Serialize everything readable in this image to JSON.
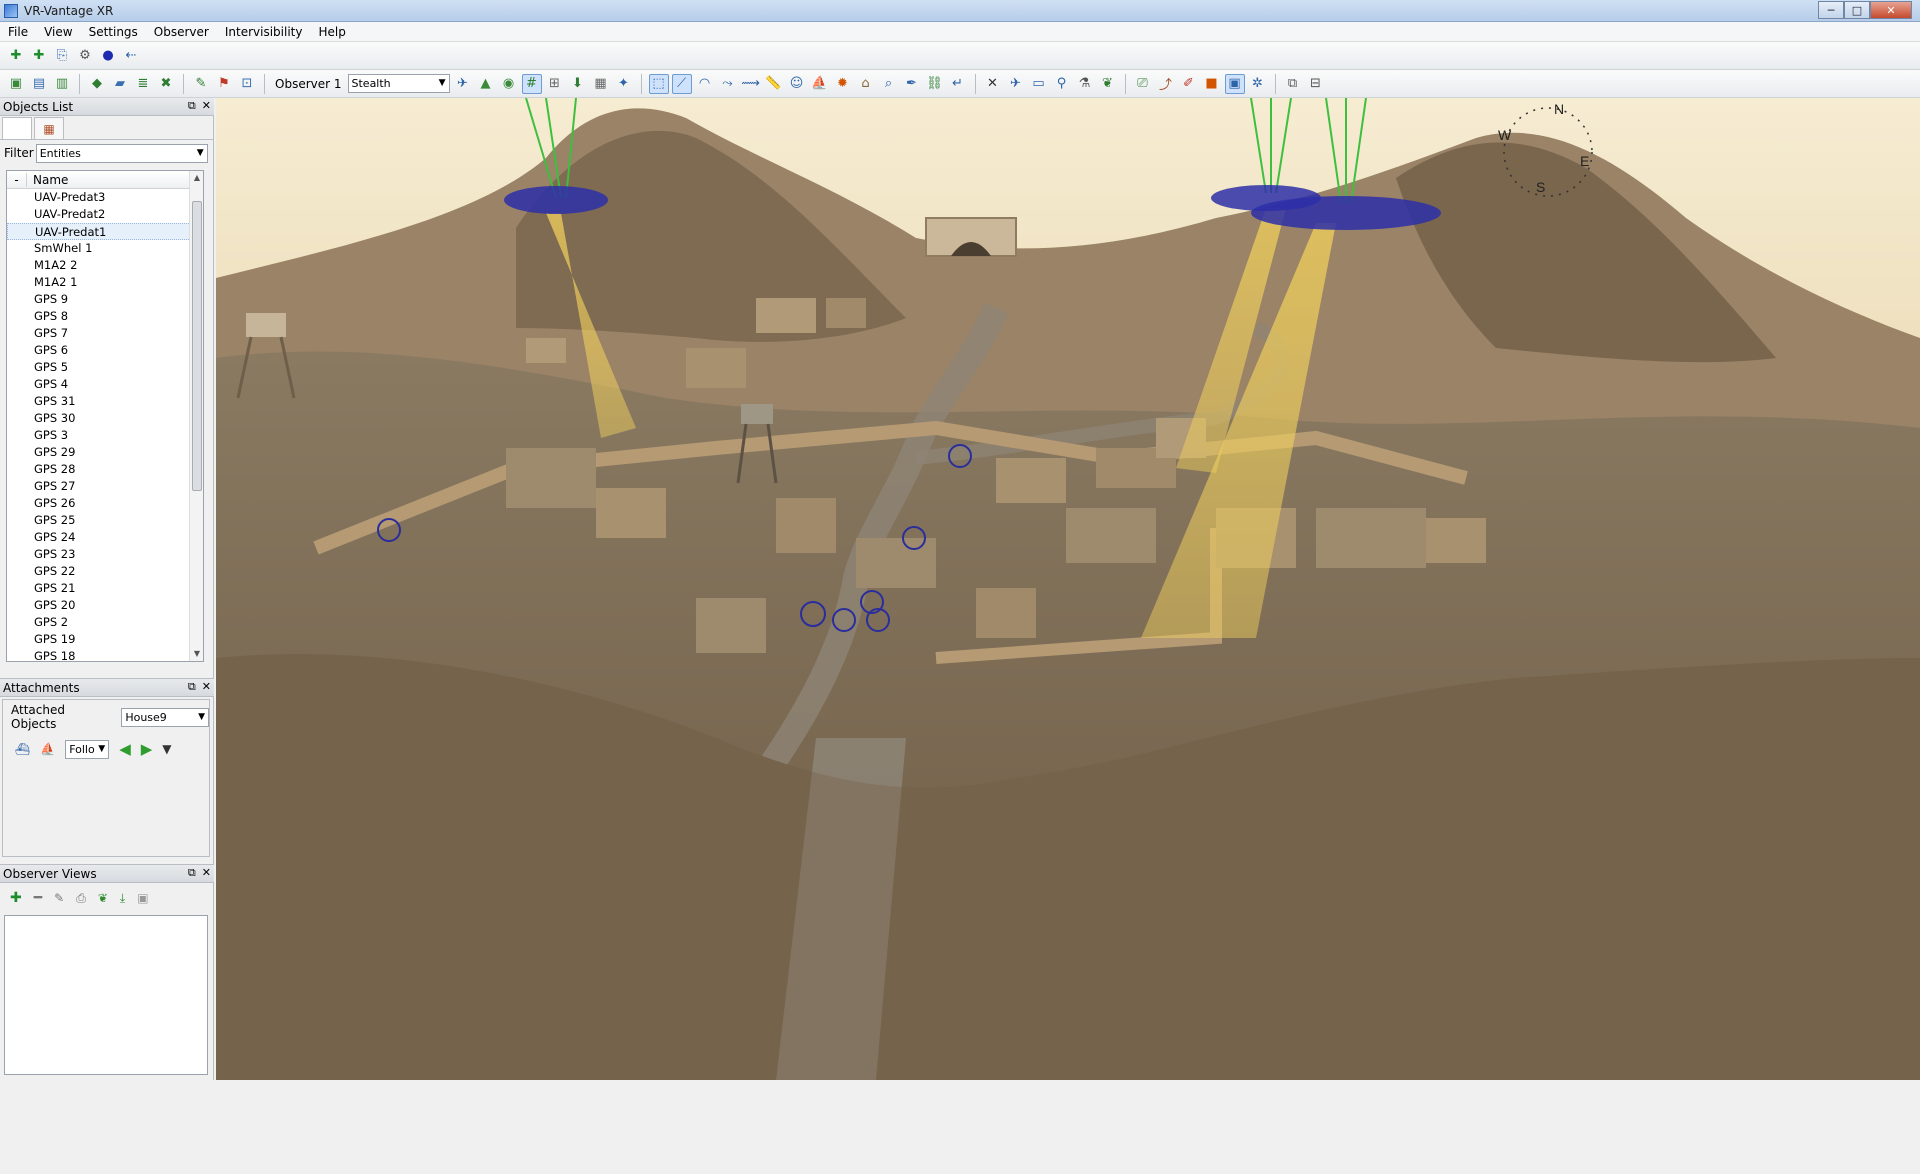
{
  "window": {
    "title": "VR-Vantage XR"
  },
  "menu": [
    "File",
    "View",
    "Settings",
    "Observer",
    "Intervisibility",
    "Help"
  ],
  "toolbar": {
    "observer_label": "Observer 1",
    "observer_mode": "Stealth"
  },
  "objects_panel": {
    "title": "Objects List",
    "filter_label": "Filter",
    "filter_value": "Entities",
    "column_sort": "-",
    "column_name": "Name",
    "items": [
      "UAV-Predat3",
      "UAV-Predat2",
      "UAV-Predat1",
      "SmWhel 1",
      "M1A2 2",
      "M1A2 1",
      "GPS 9",
      "GPS 8",
      "GPS 7",
      "GPS 6",
      "GPS 5",
      "GPS 4",
      "GPS 31",
      "GPS 30",
      "GPS 3",
      "GPS 29",
      "GPS 28",
      "GPS 27",
      "GPS 26",
      "GPS 25",
      "GPS 24",
      "GPS 23",
      "GPS 22",
      "GPS 21",
      "GPS 20",
      "GPS 2",
      "GPS 19",
      "GPS 18"
    ],
    "selected_item": "UAV-Predat1"
  },
  "attachments_panel": {
    "title": "Attachments",
    "attached_label": "Attached Objects",
    "attached_value": "House9",
    "follow_value": "Follo"
  },
  "observer_views_panel": {
    "title": "Observer Views"
  },
  "compass": {
    "n": "N",
    "e": "E",
    "s": "S",
    "w": "W"
  },
  "colors": {
    "sky_top": "#f5e9c9",
    "sky_bottom": "#d9c18c",
    "terrain": "#7d6a52",
    "sensor_cone": "#f3d25c",
    "uav_disc": "#2d2fa8",
    "sensor_beam": "#3fbf3f"
  }
}
